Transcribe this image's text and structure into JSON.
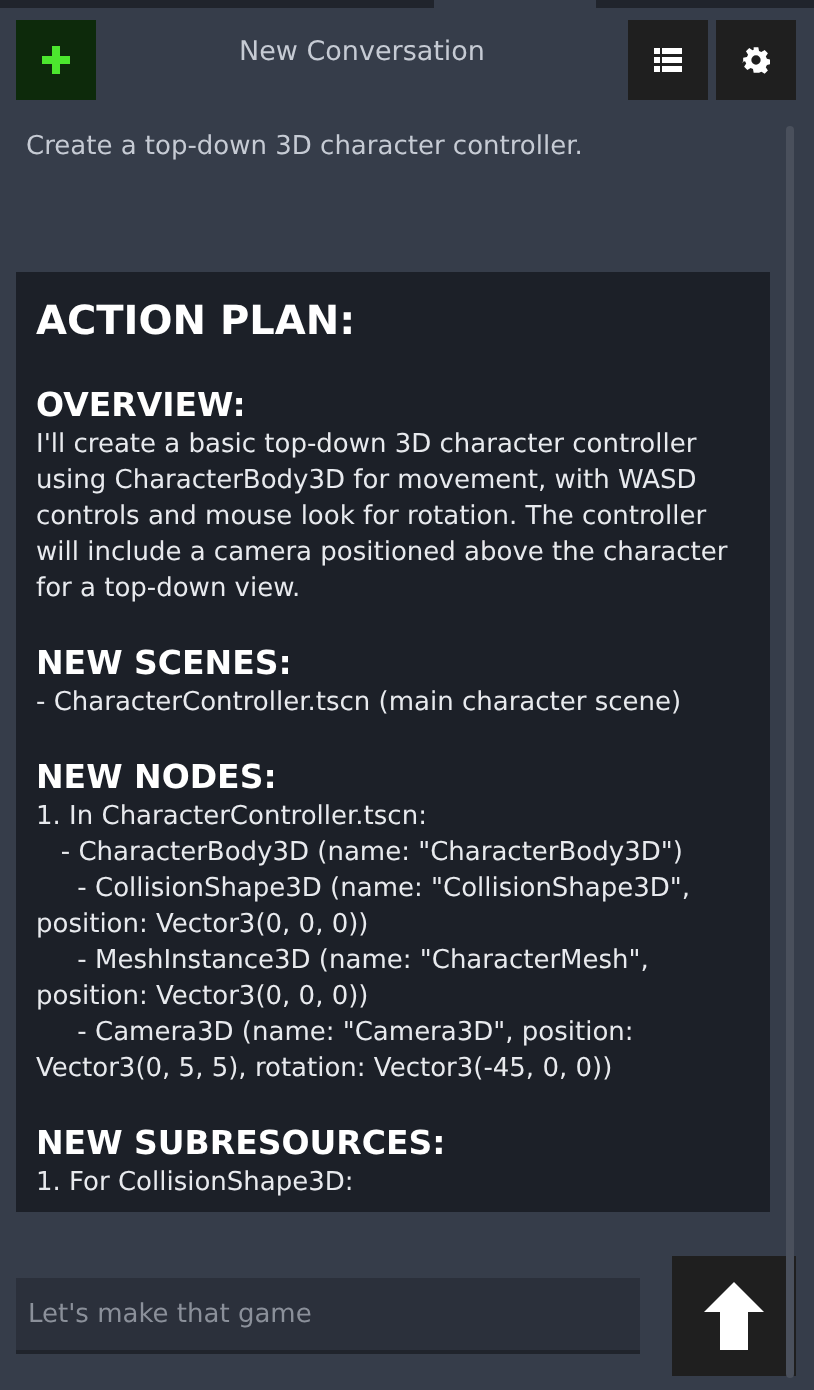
{
  "header": {
    "title": "New Conversation"
  },
  "user_message": "Create a top-down 3D character controller.",
  "response": {
    "title": "ACTION PLAN:",
    "sections": [
      {
        "heading": "OVERVIEW:",
        "lines": [
          "I'll create a basic top-down 3D character controller using CharacterBody3D for movement, with WASD controls and mouse look for rotation. The controller will include a camera positioned above the character for a top-down view."
        ]
      },
      {
        "heading": "NEW SCENES:",
        "lines": [
          "- CharacterController.tscn (main character scene)"
        ]
      },
      {
        "heading": "NEW NODES:",
        "lines": [
          "1. In CharacterController.tscn:",
          "   - CharacterBody3D (name: \"CharacterBody3D\")",
          "     - CollisionShape3D (name: \"CollisionShape3D\", position: Vector3(0, 0, 0))",
          "     - MeshInstance3D (name: \"CharacterMesh\", position: Vector3(0, 0, 0))",
          "     - Camera3D (name: \"Camera3D\", position: Vector3(0, 5, 5), rotation: Vector3(-45, 0, 0))"
        ]
      },
      {
        "heading": "NEW SUBRESOURCES:",
        "lines": [
          "1. For CollisionShape3D:"
        ]
      }
    ]
  },
  "input": {
    "placeholder": "Let's make that game"
  }
}
